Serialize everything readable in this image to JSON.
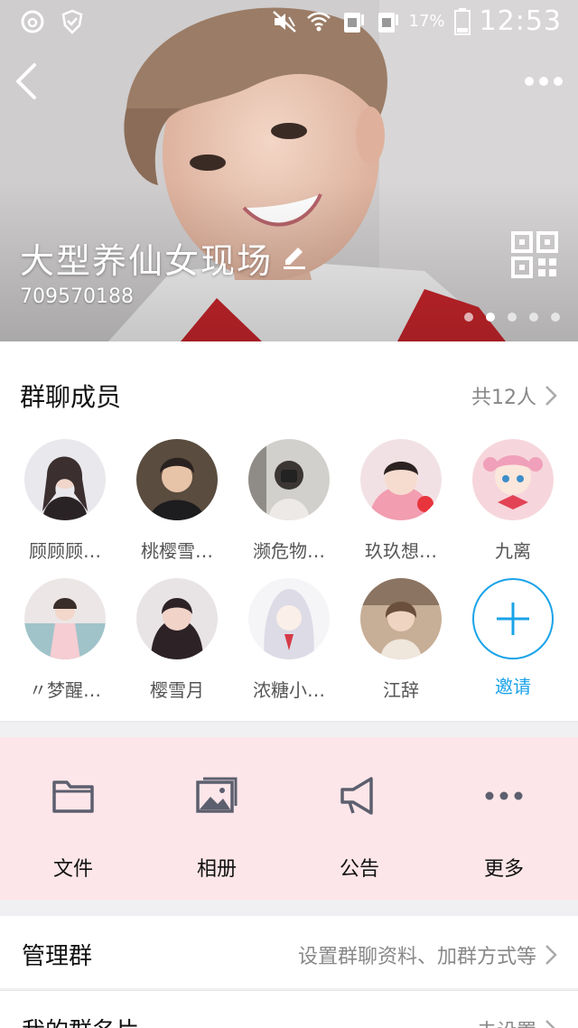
{
  "status_bar": {
    "battery_text": "17%",
    "time": "12:53"
  },
  "header": {
    "group_name": "大型养仙女现场",
    "group_id": "709570188",
    "carousel_pages": 5,
    "carousel_active_index": 1
  },
  "members": {
    "title": "群聊成员",
    "count_label": "共12人",
    "list": [
      {
        "name": "顾顾顾…",
        "color": "#c9c9cf"
      },
      {
        "name": "桃樱雪…",
        "color": "#4b4640"
      },
      {
        "name": "濒危物…",
        "color": "#bdbab6"
      },
      {
        "name": "玖玖想…",
        "color": "#f1c9cf"
      },
      {
        "name": "九离",
        "color": "#f3c6cf"
      },
      {
        "name": "〃梦醒…",
        "color": "#e3d6d8"
      },
      {
        "name": "樱雪月",
        "color": "#5b4b52"
      },
      {
        "name": "浓糖小…",
        "color": "#efeef2"
      },
      {
        "name": "江辞",
        "color": "#c9b19a"
      }
    ],
    "invite_label": "邀请"
  },
  "actions": [
    {
      "label": "文件",
      "icon": "folder-icon"
    },
    {
      "label": "相册",
      "icon": "album-icon"
    },
    {
      "label": "公告",
      "icon": "megaphone-icon"
    },
    {
      "label": "更多",
      "icon": "more-dots-icon"
    }
  ],
  "rows": {
    "manage": {
      "title": "管理群",
      "value": "设置群聊资料、加群方式等"
    },
    "my_card": {
      "title": "我的群名片",
      "value": "未设置"
    }
  },
  "colors": {
    "accent": "#1aa3e8",
    "action_strip_bg": "#fce6e9",
    "icon_gray": "#5c5f6e"
  }
}
